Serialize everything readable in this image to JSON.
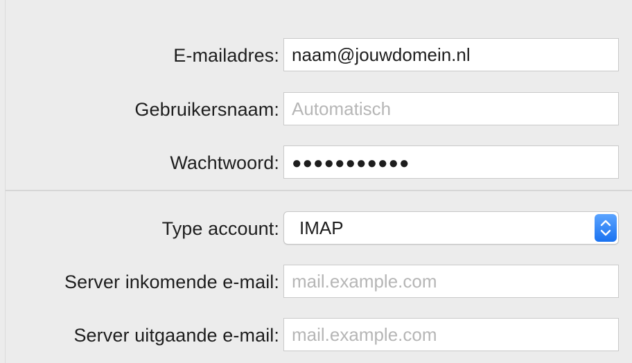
{
  "form": {
    "email": {
      "label": "E-mailadres:",
      "value": "naam@jouwdomein.nl"
    },
    "username": {
      "label": "Gebruikersnaam:",
      "placeholder": "Automatisch"
    },
    "password": {
      "label": "Wachtwoord:",
      "value": "●●●●●●●●●●●"
    },
    "account_type": {
      "label": "Type account:",
      "selected": "IMAP",
      "icon": "up-down-chevron-icon"
    },
    "incoming_server": {
      "label": "Server inkomende e-mail:",
      "placeholder": "mail.example.com"
    },
    "outgoing_server": {
      "label": "Server uitgaande e-mail:",
      "placeholder": "mail.example.com"
    }
  },
  "colors": {
    "accent": "#1a72f0",
    "background": "#ececec",
    "field_border": "#c9c9c9",
    "placeholder": "#b6b6b6"
  }
}
